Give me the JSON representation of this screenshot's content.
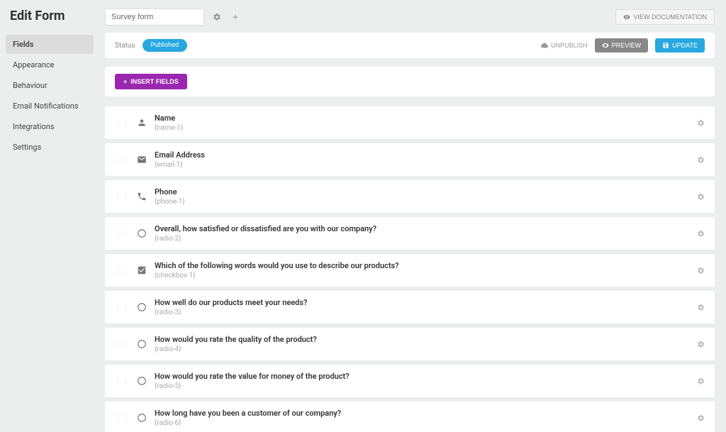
{
  "sidebar": {
    "title": "Edit Form",
    "items": [
      {
        "label": "Fields",
        "active": true
      },
      {
        "label": "Appearance",
        "active": false
      },
      {
        "label": "Behaviour",
        "active": false
      },
      {
        "label": "Email Notifications",
        "active": false
      },
      {
        "label": "Integrations",
        "active": false
      },
      {
        "label": "Settings",
        "active": false
      }
    ]
  },
  "topbar": {
    "form_name": "Survey form",
    "doc_button": "VIEW DOCUMENTATION"
  },
  "status": {
    "label": "Status",
    "badge": "Published",
    "unpublish": "UNPUBLISH",
    "preview": "PREVIEW",
    "update": "UPDATE"
  },
  "insert_button": "INSERT FIELDS",
  "fields": [
    {
      "icon": "person",
      "label": "Name",
      "slug": "{name-1}"
    },
    {
      "icon": "email",
      "label": "Email Address",
      "slug": "{email-1}"
    },
    {
      "icon": "phone",
      "label": "Phone",
      "slug": "{phone-1}"
    },
    {
      "icon": "radio",
      "label": "Overall, how satisfied or dissatisfied are you with our company?",
      "slug": "{radio-2}"
    },
    {
      "icon": "checkbox",
      "label": "Which of the following words would you use to describe our products?",
      "slug": "{checkbox-1}"
    },
    {
      "icon": "radio",
      "label": "How well do our products meet your needs?",
      "slug": "{radio-3}"
    },
    {
      "icon": "radio",
      "label": "How would you rate the quality of the product?",
      "slug": "{radio-4}"
    },
    {
      "icon": "radio",
      "label": "How would you rate the value for money of the product?",
      "slug": "{radio-5}"
    },
    {
      "icon": "radio",
      "label": "How long have you been a customer of our company?",
      "slug": "{radio-6}"
    }
  ]
}
